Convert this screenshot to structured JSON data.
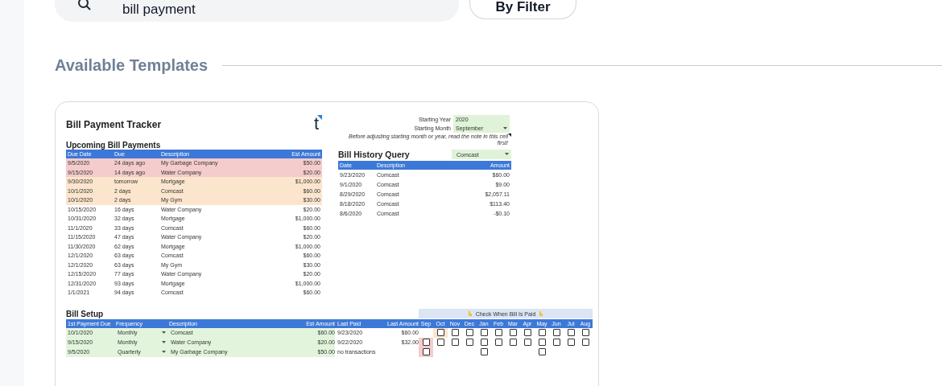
{
  "search": {
    "value": "bill payment"
  },
  "filter_button": {
    "label": "By Filter"
  },
  "section_title": "Available Templates",
  "template": {
    "title": "Bill Payment Tracker",
    "logo": "t",
    "upcoming": {
      "title": "Upcoming Bill Payments",
      "columns": [
        "Due Date",
        "Due",
        "Description",
        "Est Amount"
      ],
      "rows": [
        {
          "color": "#f4cccc",
          "cells": [
            "9/5/2020",
            "24 days ago",
            "My Garbage Company",
            "$50.00"
          ]
        },
        {
          "color": "#f4cccc",
          "cells": [
            "9/15/2020",
            "14 days ago",
            "Water Company",
            "$20.00"
          ]
        },
        {
          "color": "#fce5cd",
          "cells": [
            "9/30/2020",
            "tomorrow",
            "Mortgage",
            "$1,000.00"
          ]
        },
        {
          "color": "#fce5cd",
          "cells": [
            "10/1/2020",
            "2 days",
            "Comcast",
            "$60.00"
          ]
        },
        {
          "color": "#fce5cd",
          "cells": [
            "10/1/2020",
            "2 days",
            "My Gym",
            "$30.00"
          ]
        },
        {
          "color": "#ffffff",
          "cells": [
            "10/15/2020",
            "16 days",
            "Water Company",
            "$20.00"
          ]
        },
        {
          "color": "#ffffff",
          "cells": [
            "10/31/2020",
            "32 days",
            "Mortgage",
            "$1,000.00"
          ]
        },
        {
          "color": "#ffffff",
          "cells": [
            "11/1/2020",
            "33 days",
            "Comcast",
            "$60.00"
          ]
        },
        {
          "color": "#ffffff",
          "cells": [
            "11/15/2020",
            "47 days",
            "Water Company",
            "$20.00"
          ]
        },
        {
          "color": "#ffffff",
          "cells": [
            "11/30/2020",
            "62 days",
            "Mortgage",
            "$1,000.00"
          ]
        },
        {
          "color": "#ffffff",
          "cells": [
            "12/1/2020",
            "63 days",
            "Comcast",
            "$60.00"
          ]
        },
        {
          "color": "#ffffff",
          "cells": [
            "12/1/2020",
            "63 days",
            "My Gym",
            "$30.00"
          ]
        },
        {
          "color": "#ffffff",
          "cells": [
            "12/15/2020",
            "77 days",
            "Water Company",
            "$20.00"
          ]
        },
        {
          "color": "#ffffff",
          "cells": [
            "12/31/2020",
            "93 days",
            "Mortgage",
            "$1,000.00"
          ]
        },
        {
          "color": "#ffffff",
          "cells": [
            "1/1/2021",
            "94 days",
            "Comcast",
            "$60.00"
          ]
        }
      ]
    },
    "settings": [
      {
        "label": "Starting Year",
        "value": "2020",
        "dropdown": false
      },
      {
        "label": "Starting Month",
        "value": "September",
        "dropdown": true
      }
    ],
    "note": "Before adjusting starting month or year, read the note in this cell first!",
    "history": {
      "title": "Bill History Query",
      "filter": "Comcast",
      "columns": [
        "Date",
        "Description",
        "Amount"
      ],
      "rows": [
        [
          "9/23/2020",
          "Comcast",
          "$60.00"
        ],
        [
          "9/1/2020",
          "Comcast",
          "$9.00"
        ],
        [
          "8/29/2020",
          "Comcast",
          "$2,057.11"
        ],
        [
          "8/18/2020",
          "Comcast",
          "$113.40"
        ],
        [
          "8/6/2020",
          "Comcast",
          "-$0.10"
        ]
      ]
    },
    "setup": {
      "title": "Bill Setup",
      "banner": "Check When Bill Is Paid",
      "columns": [
        "1st Payment Due",
        "Frequency",
        "Description",
        "Est Amount",
        "Last Paid",
        "Last Amount"
      ],
      "months": [
        "Sep",
        "Oct",
        "Nov",
        "Dec",
        "Jan",
        "Feb",
        "Mar",
        "Apr",
        "May",
        "Jun",
        "Jul",
        "Aug"
      ],
      "rows": [
        {
          "cells": [
            "10/1/2020",
            "Monthly",
            "Comcast",
            "$60.00",
            "9/23/2020",
            "$60.00"
          ],
          "month_cells": [
            {
              "kind": "none"
            },
            {
              "kind": "box-due",
              "checked": false
            },
            {
              "kind": "box",
              "checked": false
            },
            {
              "kind": "box",
              "checked": false
            },
            {
              "kind": "box",
              "checked": false
            },
            {
              "kind": "box",
              "checked": false
            },
            {
              "kind": "box",
              "checked": false
            },
            {
              "kind": "box",
              "checked": false
            },
            {
              "kind": "box",
              "checked": false
            },
            {
              "kind": "box",
              "checked": false
            },
            {
              "kind": "box",
              "checked": false
            },
            {
              "kind": "box",
              "checked": false
            }
          ]
        },
        {
          "cells": [
            "9/15/2020",
            "Monthly",
            "Water Company",
            "$20.00",
            "9/22/2020",
            "$32.00"
          ],
          "month_cells": [
            {
              "kind": "box-overdue",
              "checked": false
            },
            {
              "kind": "box",
              "checked": false
            },
            {
              "kind": "box",
              "checked": false
            },
            {
              "kind": "box",
              "checked": false
            },
            {
              "kind": "box",
              "checked": false
            },
            {
              "kind": "box",
              "checked": false
            },
            {
              "kind": "box",
              "checked": false
            },
            {
              "kind": "box",
              "checked": false
            },
            {
              "kind": "box",
              "checked": false
            },
            {
              "kind": "box",
              "checked": false
            },
            {
              "kind": "box",
              "checked": false
            },
            {
              "kind": "box",
              "checked": false
            }
          ]
        },
        {
          "cells": [
            "9/5/2020",
            "Quarterly",
            "My Garbage Company",
            "$50.00",
            "no transactions"
          ],
          "month_cells": [
            {
              "kind": "box-overdue",
              "checked": false
            },
            {
              "kind": "none"
            },
            {
              "kind": "none"
            },
            {
              "kind": "none"
            },
            {
              "kind": "box",
              "checked": false
            },
            {
              "kind": "none"
            },
            {
              "kind": "none"
            },
            {
              "kind": "none"
            },
            {
              "kind": "box",
              "checked": false
            },
            {
              "kind": "none"
            },
            {
              "kind": "none"
            },
            {
              "kind": "none"
            }
          ]
        }
      ]
    }
  }
}
